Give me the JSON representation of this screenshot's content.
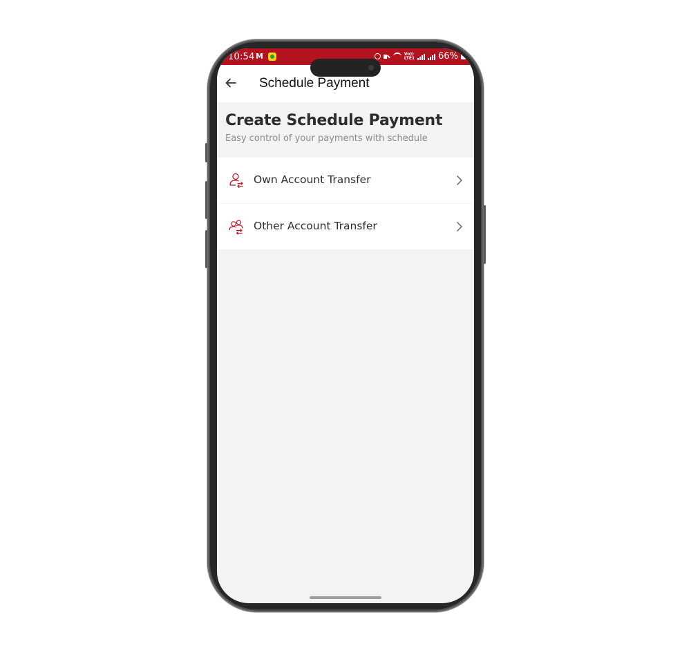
{
  "status_bar": {
    "time": "10:54",
    "mail_icon": "M",
    "network_label_top": "Vo))",
    "network_label_bottom": "LTE1",
    "battery": "66%",
    "background_color": "#b3121f"
  },
  "header": {
    "title": "Schedule Payment",
    "back_icon": "arrow-left-icon"
  },
  "intro": {
    "title": "Create Schedule Payment",
    "subtitle": "Easy control of your payments with schedule"
  },
  "menu": {
    "items": [
      {
        "label": "Own Account Transfer",
        "icon": "own-account-transfer-icon"
      },
      {
        "label": "Other Account Transfer",
        "icon": "other-account-transfer-icon"
      }
    ],
    "accent_color": "#c0182a"
  }
}
